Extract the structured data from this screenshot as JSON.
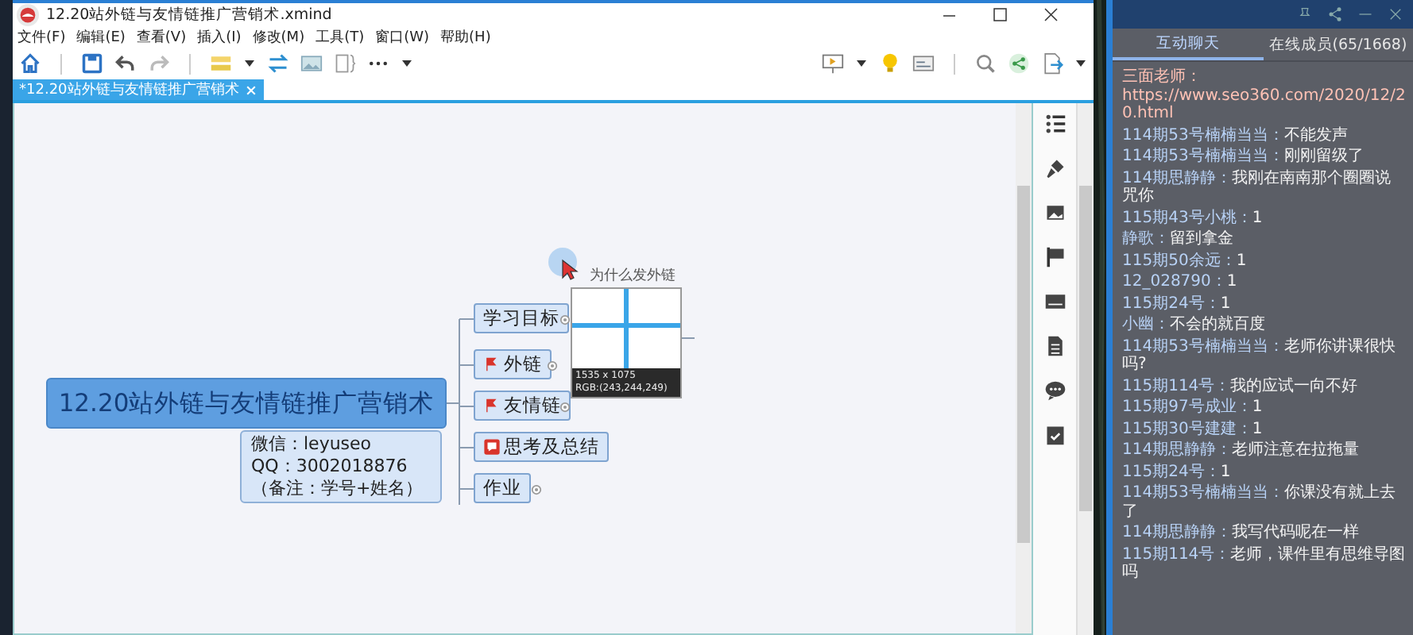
{
  "window": {
    "title": "12.20站外链与友情链推广营销术.xmind"
  },
  "menu": [
    "文件(F)",
    "编辑(E)",
    "查看(V)",
    "插入(I)",
    "修改(M)",
    "工具(T)",
    "窗口(W)",
    "帮助(H)"
  ],
  "tab": {
    "label": "*12.20站外链与友情链推广营销术",
    "selected": true
  },
  "mindmap": {
    "central": "12.20站外链与友情链推广营销术",
    "note": [
      "微信：leyuseo",
      "QQ：3002018876",
      "（备注：学号+姓名）"
    ],
    "topics": [
      {
        "label": "学习目标",
        "kind": "plain",
        "collapsed": true
      },
      {
        "label": "外链",
        "kind": "flag",
        "collapsed": true
      },
      {
        "label": "友情链",
        "kind": "flag",
        "collapsed": true
      },
      {
        "label": "思考及总结",
        "kind": "comment",
        "collapsed": false
      },
      {
        "label": "作业",
        "kind": "plain",
        "collapsed": true
      }
    ],
    "partial_label": "为什么发外链",
    "magnifier": {
      "size": "1535 x 1075",
      "rgb_reading": "RGB:(243,244,249)"
    }
  },
  "chat": {
    "tabs": [
      {
        "label": "互动聊天",
        "selected": true
      },
      {
        "label": "在线成员(65/1668)",
        "selected": false
      }
    ],
    "messages": [
      {
        "kind": "link",
        "name": "三面老师：",
        "text": "https://www.seo360.com/2020/12/20.html"
      },
      {
        "kind": "text",
        "name": "114期53号楠楠当当：",
        "text": "不能发声"
      },
      {
        "kind": "text",
        "name": "114期53号楠楠当当：",
        "text": "刚刚留级了"
      },
      {
        "kind": "text",
        "name": "114期思静静：",
        "text": "我刚在南南那个圈圈说咒你"
      },
      {
        "kind": "text",
        "name": "115期43号小桃：",
        "text": "1"
      },
      {
        "kind": "text",
        "name": "静歌：",
        "text": "留到拿金"
      },
      {
        "kind": "text",
        "name": "115期50余远：",
        "text": "1"
      },
      {
        "kind": "text",
        "name": "12_028790：",
        "text": "1"
      },
      {
        "kind": "text",
        "name": "115期24号：",
        "text": "1"
      },
      {
        "kind": "text",
        "name": "小幽：",
        "text": "不会的就百度"
      },
      {
        "kind": "text",
        "name": "114期53号楠楠当当：",
        "text": "老师你讲课很快吗?"
      },
      {
        "kind": "text",
        "name": "115期114号：",
        "text": "我的应试一向不好"
      },
      {
        "kind": "text",
        "name": "115期97号成业：",
        "text": "1"
      },
      {
        "kind": "text",
        "name": "115期30号建建：",
        "text": "1"
      },
      {
        "kind": "text",
        "name": "114期思静静：",
        "text": "老师注意在拉拖量"
      },
      {
        "kind": "text",
        "name": "115期24号：",
        "text": "1"
      },
      {
        "kind": "text",
        "name": "114期53号楠楠当当：",
        "text": "你课没有就上去了"
      },
      {
        "kind": "text",
        "name": "114期思静静：",
        "text": "我写代码呢在一样"
      },
      {
        "kind": "text",
        "name": "115期114号：",
        "text": "老师，课件里有思维导图吗"
      }
    ]
  }
}
